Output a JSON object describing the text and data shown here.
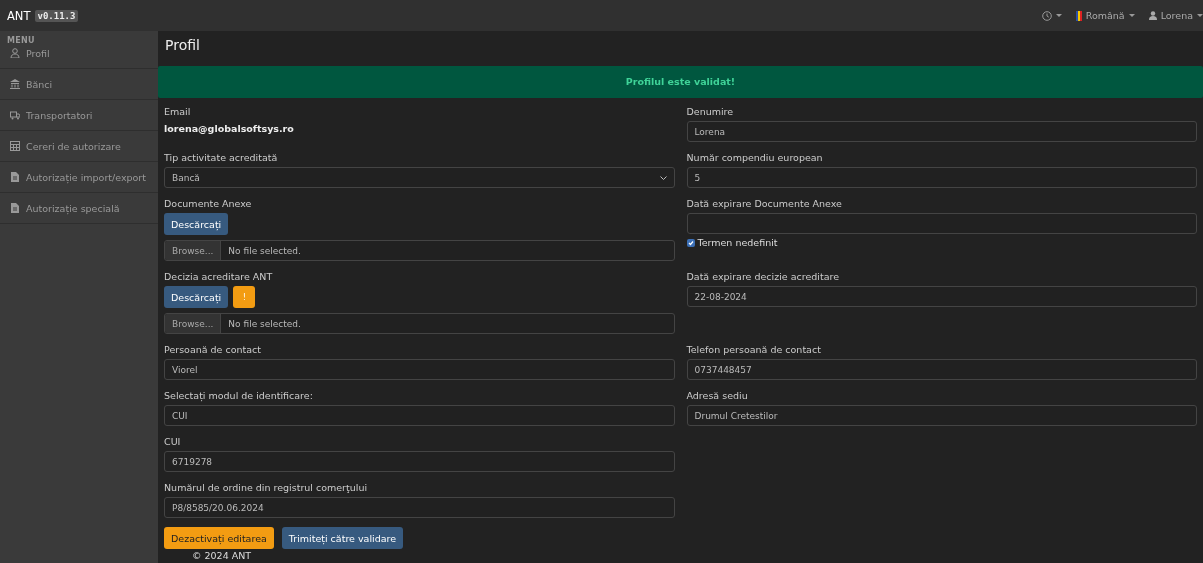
{
  "topbar": {
    "brand": "ANT",
    "version": "v0.11.3",
    "language": "Română",
    "user": "Lorena"
  },
  "sidebar": {
    "heading": "MENU",
    "items": [
      {
        "label": "Profil"
      },
      {
        "label": "Bănci"
      },
      {
        "label": "Transportatori"
      },
      {
        "label": "Cereri de autorizare"
      },
      {
        "label": "Autorizație import/export"
      },
      {
        "label": "Autorizație specială"
      }
    ]
  },
  "page": {
    "title": "Profil",
    "alert": "Profilul este validat!"
  },
  "form": {
    "left": [
      {
        "kind": "static",
        "label": "Email",
        "value": "lorena@globalsoftsys.ro"
      },
      {
        "kind": "select",
        "label": "Tip activitate acreditată",
        "value": "Bancă"
      },
      {
        "kind": "file",
        "label": "Documente Anexe",
        "download": "Descărcați",
        "browse": "Browse...",
        "file": "No file selected."
      },
      {
        "kind": "file",
        "label": "Decizia acreditare ANT",
        "download": "Descărcați",
        "warning": "!",
        "browse": "Browse...",
        "file": "No file selected."
      },
      {
        "kind": "input",
        "label": "Persoană de contact",
        "value": "Viorel"
      },
      {
        "kind": "input",
        "label": "Selectați modul de identificare:",
        "value": "CUI"
      },
      {
        "kind": "input",
        "label": "CUI",
        "value": "6719278"
      },
      {
        "kind": "input",
        "label": "Numărul de ordine din registrul comerţului",
        "value": "P8/8585/20.06.2024"
      }
    ],
    "right": [
      {
        "kind": "input",
        "label": "Denumire",
        "value": "Lorena"
      },
      {
        "kind": "input",
        "label": "Număr compendiu european",
        "value": "5"
      },
      {
        "kind": "input",
        "label": "Dată expirare Documente Anexe",
        "checkbox": {
          "label": "Termen nedefinit",
          "checked": true
        }
      },
      {
        "kind": "input",
        "label": "Dată expirare decizie acreditare",
        "value": "22-08-2024"
      },
      {
        "kind": "input",
        "label": "Telefon persoană de contact",
        "value": "0737448457"
      },
      {
        "kind": "input",
        "label": "Adresă sediu",
        "value": "Drumul Cretestilor"
      }
    ],
    "buttons": [
      {
        "label": "Dezactivați editarea",
        "kind": "warning"
      },
      {
        "label": "Trimiteți către validare",
        "kind": "primary"
      }
    ]
  },
  "footer": "© 2024 ANT"
}
